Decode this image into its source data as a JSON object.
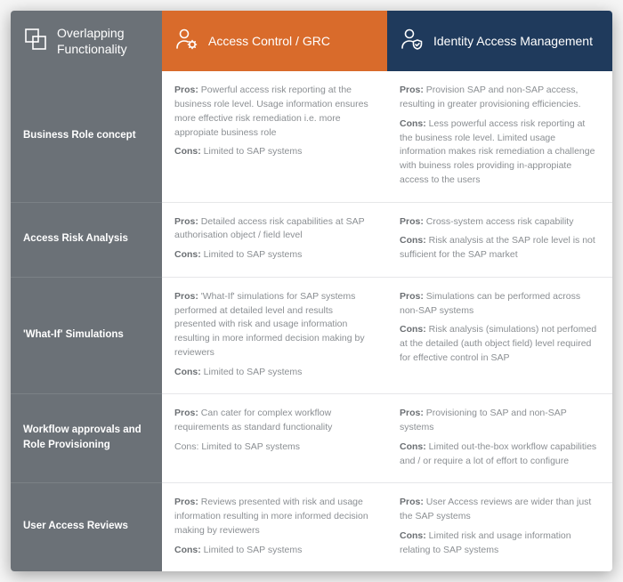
{
  "headers": {
    "col1": "Overlapping Functionality",
    "col2": "Access Control / GRC",
    "col3": "Identity Access Management"
  },
  "labels": {
    "pros": "Pros:",
    "cons": "Cons:"
  },
  "rows": [
    {
      "title": "Business Role concept",
      "grc_pros": "Powerful access risk reporting at the business role level. Usage information ensures more effective risk remediation i.e. more appropiate business role",
      "grc_cons": "Limited to SAP systems",
      "iam_pros": "Provision SAP and non-SAP access, resulting in greater provisioning efficiencies.",
      "iam_cons": "Less powerful access risk reporting at the business role level. Limited usage information makes risk remediation a challenge with buiness roles providing in-appropiate access to the users"
    },
    {
      "title": "Access Risk Analysis",
      "grc_pros": "Detailed access risk capabilities at SAP authorisation object / field level",
      "grc_cons": "Limited to SAP systems",
      "iam_pros": "Cross-system access risk capability",
      "iam_cons": "Risk analysis at the SAP role level is not sufficient for the SAP market"
    },
    {
      "title": "'What-If' Simulations",
      "grc_pros": "'What-If' simulations for SAP systems performed at detailed level and results presented with risk and usage information resulting in more informed decision making by reviewers",
      "grc_cons": "Limited to SAP systems",
      "iam_pros": "Simulations can be performed across non-SAP systems",
      "iam_cons": "Risk analysis (simulations) not perfomed at the detailed (auth object field) level required for effective control in SAP"
    },
    {
      "title": "Workflow approvals and Role Provisioning",
      "grc_pros": "Can cater for complex workflow requirements as standard functionality",
      "grc_cons": "Cons: Limited to SAP systems",
      "grc_cons_nolabel": true,
      "iam_pros": "Provisioning to SAP and non-SAP systems",
      "iam_cons": "Limited out-the-box workflow capabilities and / or require a lot of effort to configure"
    },
    {
      "title": "User Access Reviews",
      "grc_pros": "Reviews presented with risk and usage information resulting in more informed decision making by reviewers",
      "grc_cons": "Limited to SAP systems",
      "iam_pros": "User Access reviews are wider than just the SAP systems",
      "iam_cons": "Limited risk and usage information relating to SAP systems"
    }
  ]
}
